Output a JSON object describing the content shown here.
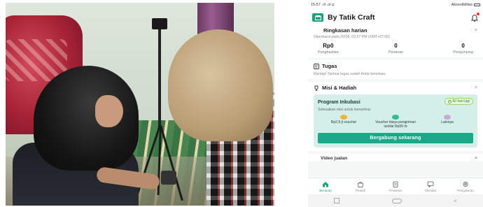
{
  "status_bar": {
    "time": "15.57 .ııl .ııl ⩍",
    "right_label": "Aksesibilitas"
  },
  "header": {
    "shop_name": "By Tatik Craft",
    "logo_glyph": "🏪",
    "bell_icon": "bell-icon"
  },
  "summary": {
    "title": "Ringkasan harian",
    "updated": "Diperbarui pada 20/08, 03.57 PM (GMT+07:00)",
    "stats": [
      {
        "value": "Rp0",
        "label": "Penghasilan"
      },
      {
        "value": "0",
        "label": "Pesanan"
      },
      {
        "value": "0",
        "label": "Pengunjung"
      }
    ]
  },
  "tasks": {
    "title": "Tugas",
    "message": "Mantap! Semua tugas sudah Anda bereskan."
  },
  "missions": {
    "title": "Misi & Hadiah",
    "program": {
      "title": "Program Inkubasi",
      "days_left": "82 hari lagi",
      "subtitle": "Selesaikan misi untuk menerima:",
      "rewards": [
        {
          "label": "Rp2,9 jt voucher",
          "color": "#f2b33d"
        },
        {
          "label": "Voucher biaya pengiriman senilai Rp99 rb",
          "color": "#2fbf8f"
        },
        {
          "label": "Lainnya",
          "color": "#c9a9d6"
        }
      ],
      "button": "Bergabung sekarang"
    }
  },
  "video_peek": {
    "title": "Video jualan"
  },
  "bottom_nav": [
    {
      "label": "Beranda",
      "active": true
    },
    {
      "label": "Produk",
      "active": false
    },
    {
      "label": "Pesanan",
      "active": false
    },
    {
      "label": "Obrolan",
      "active": false
    },
    {
      "label": "Pengaturan",
      "active": false
    }
  ],
  "colors": {
    "accent": "#1aa37a",
    "banner_bg": "#d3efe8",
    "button": "#19a889"
  }
}
